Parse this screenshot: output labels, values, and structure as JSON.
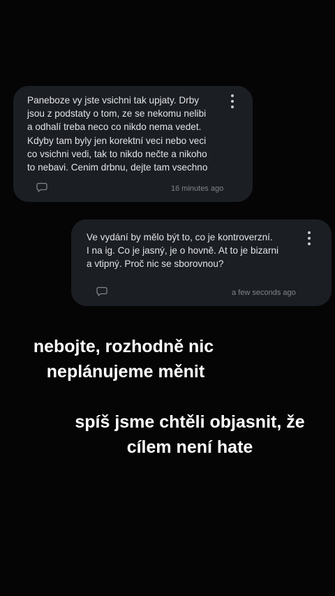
{
  "comments": [
    {
      "text": "Paneboze vy jste vsichni tak upjaty. Drby\njsou z podstaty o tom, ze se nekomu nelibi\na odhalí treba neco co nikdo nema vedet.\nKdyby tam byly jen korektní veci nebo veci\nco vsichni vedi, tak to nikdo nečte a nikoho\nto nebavi. Cenim drbnu, dejte tam vsechno",
      "timestamp": "16 minutes ago",
      "icons": {
        "menu": "more-vertical-icon",
        "reply": "comment-bubble-icon"
      }
    },
    {
      "text": "Ve vydání by mělo být to, co je kontroverzní.\nI na ig. Co je jasný, je o hovně. At to je bizarni\na vtipný. Proč nic se sborovnou?",
      "timestamp": "a few seconds ago",
      "icons": {
        "menu": "more-vertical-icon",
        "reply": "comment-bubble-icon"
      }
    }
  ],
  "overlay": {
    "caption_1": [
      "nebojte, rozhodně nic",
      "neplánujeme měnit"
    ],
    "caption_2": [
      "spíš jsme chtěli objasnit, že",
      "cílem není hate"
    ]
  },
  "colors": {
    "background": "#050505",
    "card": "#1b1e23",
    "card_text": "#e3e4e6",
    "timestamp": "#80858c",
    "overlay_text": "#ffffff"
  }
}
